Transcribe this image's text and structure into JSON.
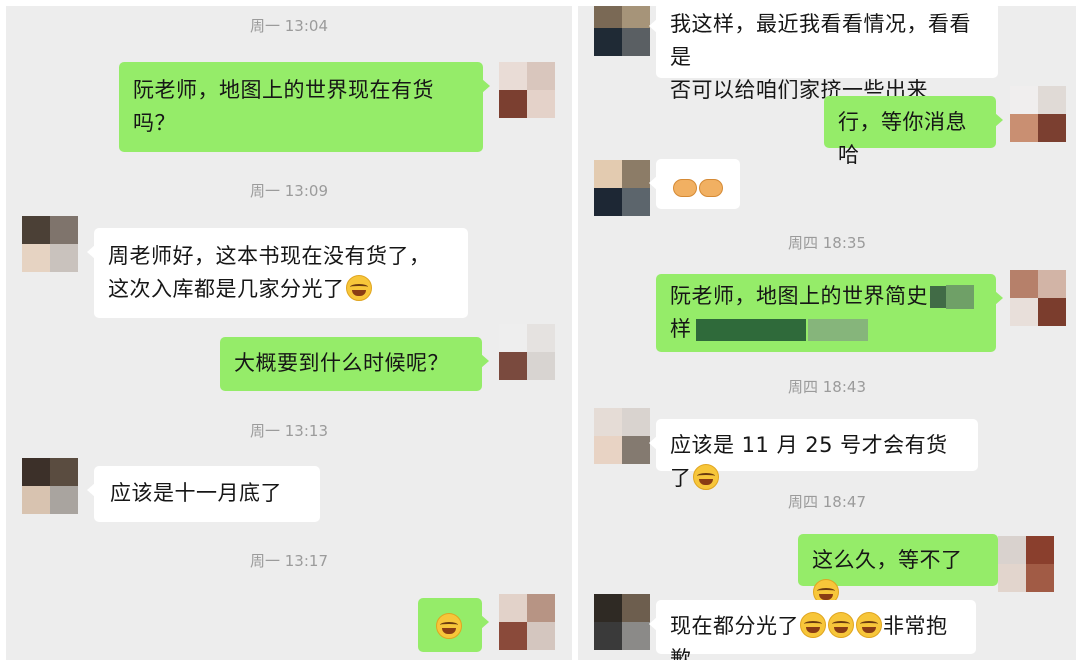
{
  "left": {
    "timestamps": [
      "周一 13:04",
      "周一 13:09",
      "周一 13:13",
      "周一 13:17"
    ],
    "messages": [
      {
        "lines": [
          "阮老师，地图上的世界现在有货",
          "吗？"
        ]
      },
      {
        "lines": [
          "周老师好，这本书现在没有货了，",
          "这次入库都是几家分光了"
        ]
      },
      {
        "text": "大概要到什么时候呢？"
      },
      {
        "text": "应该是十一月底了"
      },
      {
        "emoji": "face-with-tears-of-joy-icon"
      }
    ]
  },
  "right": {
    "timestamps": [
      "周四 18:35",
      "周四 18:43",
      "周四 18:47"
    ],
    "messages": [
      {
        "lines": [
          "我这样，最近我看看情况，看看是",
          "否可以给咱们家挤一些出来"
        ]
      },
      {
        "text": "行，等你消息哈"
      },
      {
        "emoji": "handshake-icon"
      },
      {
        "lines": [
          "阮老师，地图上的世界简史",
          "样"
        ]
      },
      {
        "text": "应该是 11 月 25 号才会有货了"
      },
      {
        "text": "这么久，等不了"
      },
      {
        "text_before": "现在都分光了",
        "text_after": "非常抱歉"
      }
    ]
  },
  "colors": {
    "sent_bubble": "#95ec69",
    "received_bubble": "#ffffff",
    "background": "#ededed",
    "timestamp": "#9b9b9b"
  }
}
